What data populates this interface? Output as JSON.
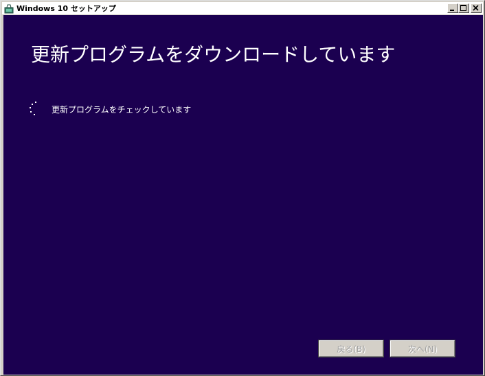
{
  "window": {
    "title": "Windows 10 セットアップ"
  },
  "main": {
    "heading": "更新プログラムをダウンロードしています",
    "status": "更新プログラムをチェックしています"
  },
  "footer": {
    "back_label": "戻る(B)",
    "next_label": "次へ(N)",
    "back_enabled": false,
    "next_enabled": false
  },
  "colors": {
    "background": "#1b0050",
    "text": "#ffffff",
    "disabled_text": "#a0a0a0"
  },
  "icons": {
    "app": "windows-setup-icon",
    "spinner": "loading-spinner-icon"
  }
}
